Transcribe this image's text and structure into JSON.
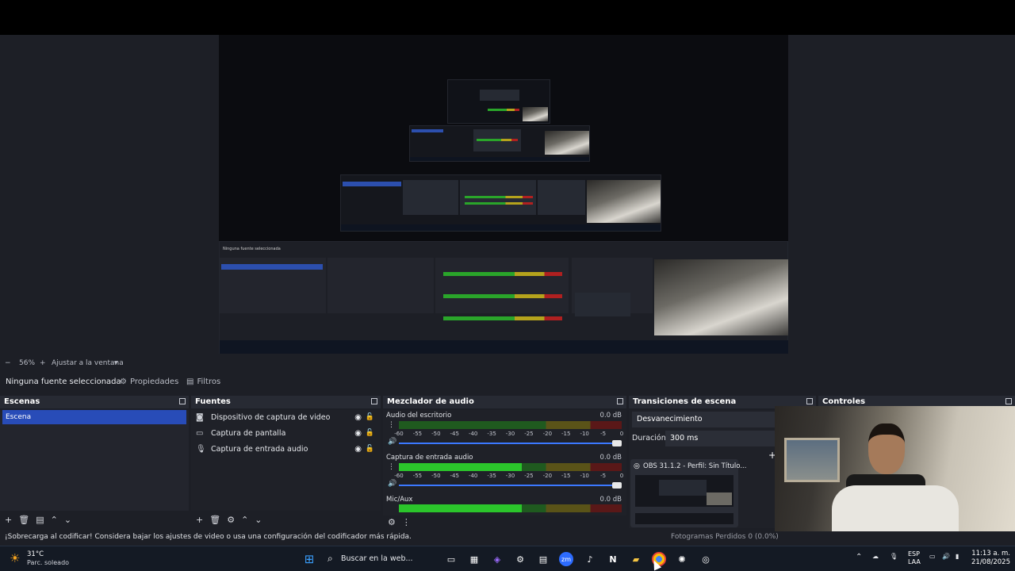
{
  "preview": {
    "zoom": "56%",
    "fit_label": "Ajustar a la ventana"
  },
  "toolbar": {
    "no_source": "Ninguna fuente seleccionada",
    "properties": "Propiedades",
    "filters": "Filtros"
  },
  "scenes": {
    "title": "Escenas",
    "items": [
      "Escena"
    ]
  },
  "sources": {
    "title": "Fuentes",
    "items": [
      {
        "label": "Dispositivo de captura de video",
        "icon": "camera-icon"
      },
      {
        "label": "Captura de pantalla",
        "icon": "monitor-icon"
      },
      {
        "label": "Captura de entrada audio",
        "icon": "mic-icon"
      }
    ]
  },
  "mixer": {
    "title": "Mezclador de audio",
    "ticks": [
      "-60",
      "-55",
      "-50",
      "-45",
      "-40",
      "-35",
      "-30",
      "-25",
      "-20",
      "-15",
      "-10",
      "-5",
      "0"
    ],
    "channels": [
      {
        "name": "Audio del escritorio",
        "db": "0.0 dB",
        "level": 0.0
      },
      {
        "name": "Captura de entrada audio",
        "db": "0.0 dB",
        "level": 0.55
      },
      {
        "name": "Mic/Aux",
        "db": "0.0 dB",
        "level": 0.55
      }
    ]
  },
  "transitions": {
    "title": "Transiciones de escena",
    "selected": "Desvanecimiento",
    "duration_label": "Duración",
    "duration_value": "300 ms",
    "window_preview_title": "OBS 31.1.2 - Perfil: Sin Título..."
  },
  "controls": {
    "title": "Controles"
  },
  "status": {
    "warning": "¡Sobrecarga al codificar! Considera bajar los ajustes de video o usa una configuración del codificador más rápida.",
    "frames": "Fotogramas Perdidos 0 (0.0%)"
  },
  "taskbar": {
    "weather_temp": "31°C",
    "weather_desc": "Parc. soleado",
    "search_placeholder": "Buscar en la web...",
    "lang": "ESP",
    "lang_sub": "LAA",
    "time": "11:13 a. m.",
    "date": "21/08/2025"
  },
  "colors": {
    "accent": "#284cb8",
    "meter_green": "#2bc52b",
    "meter_yellow": "#b5a31c",
    "meter_red": "#b02020"
  }
}
